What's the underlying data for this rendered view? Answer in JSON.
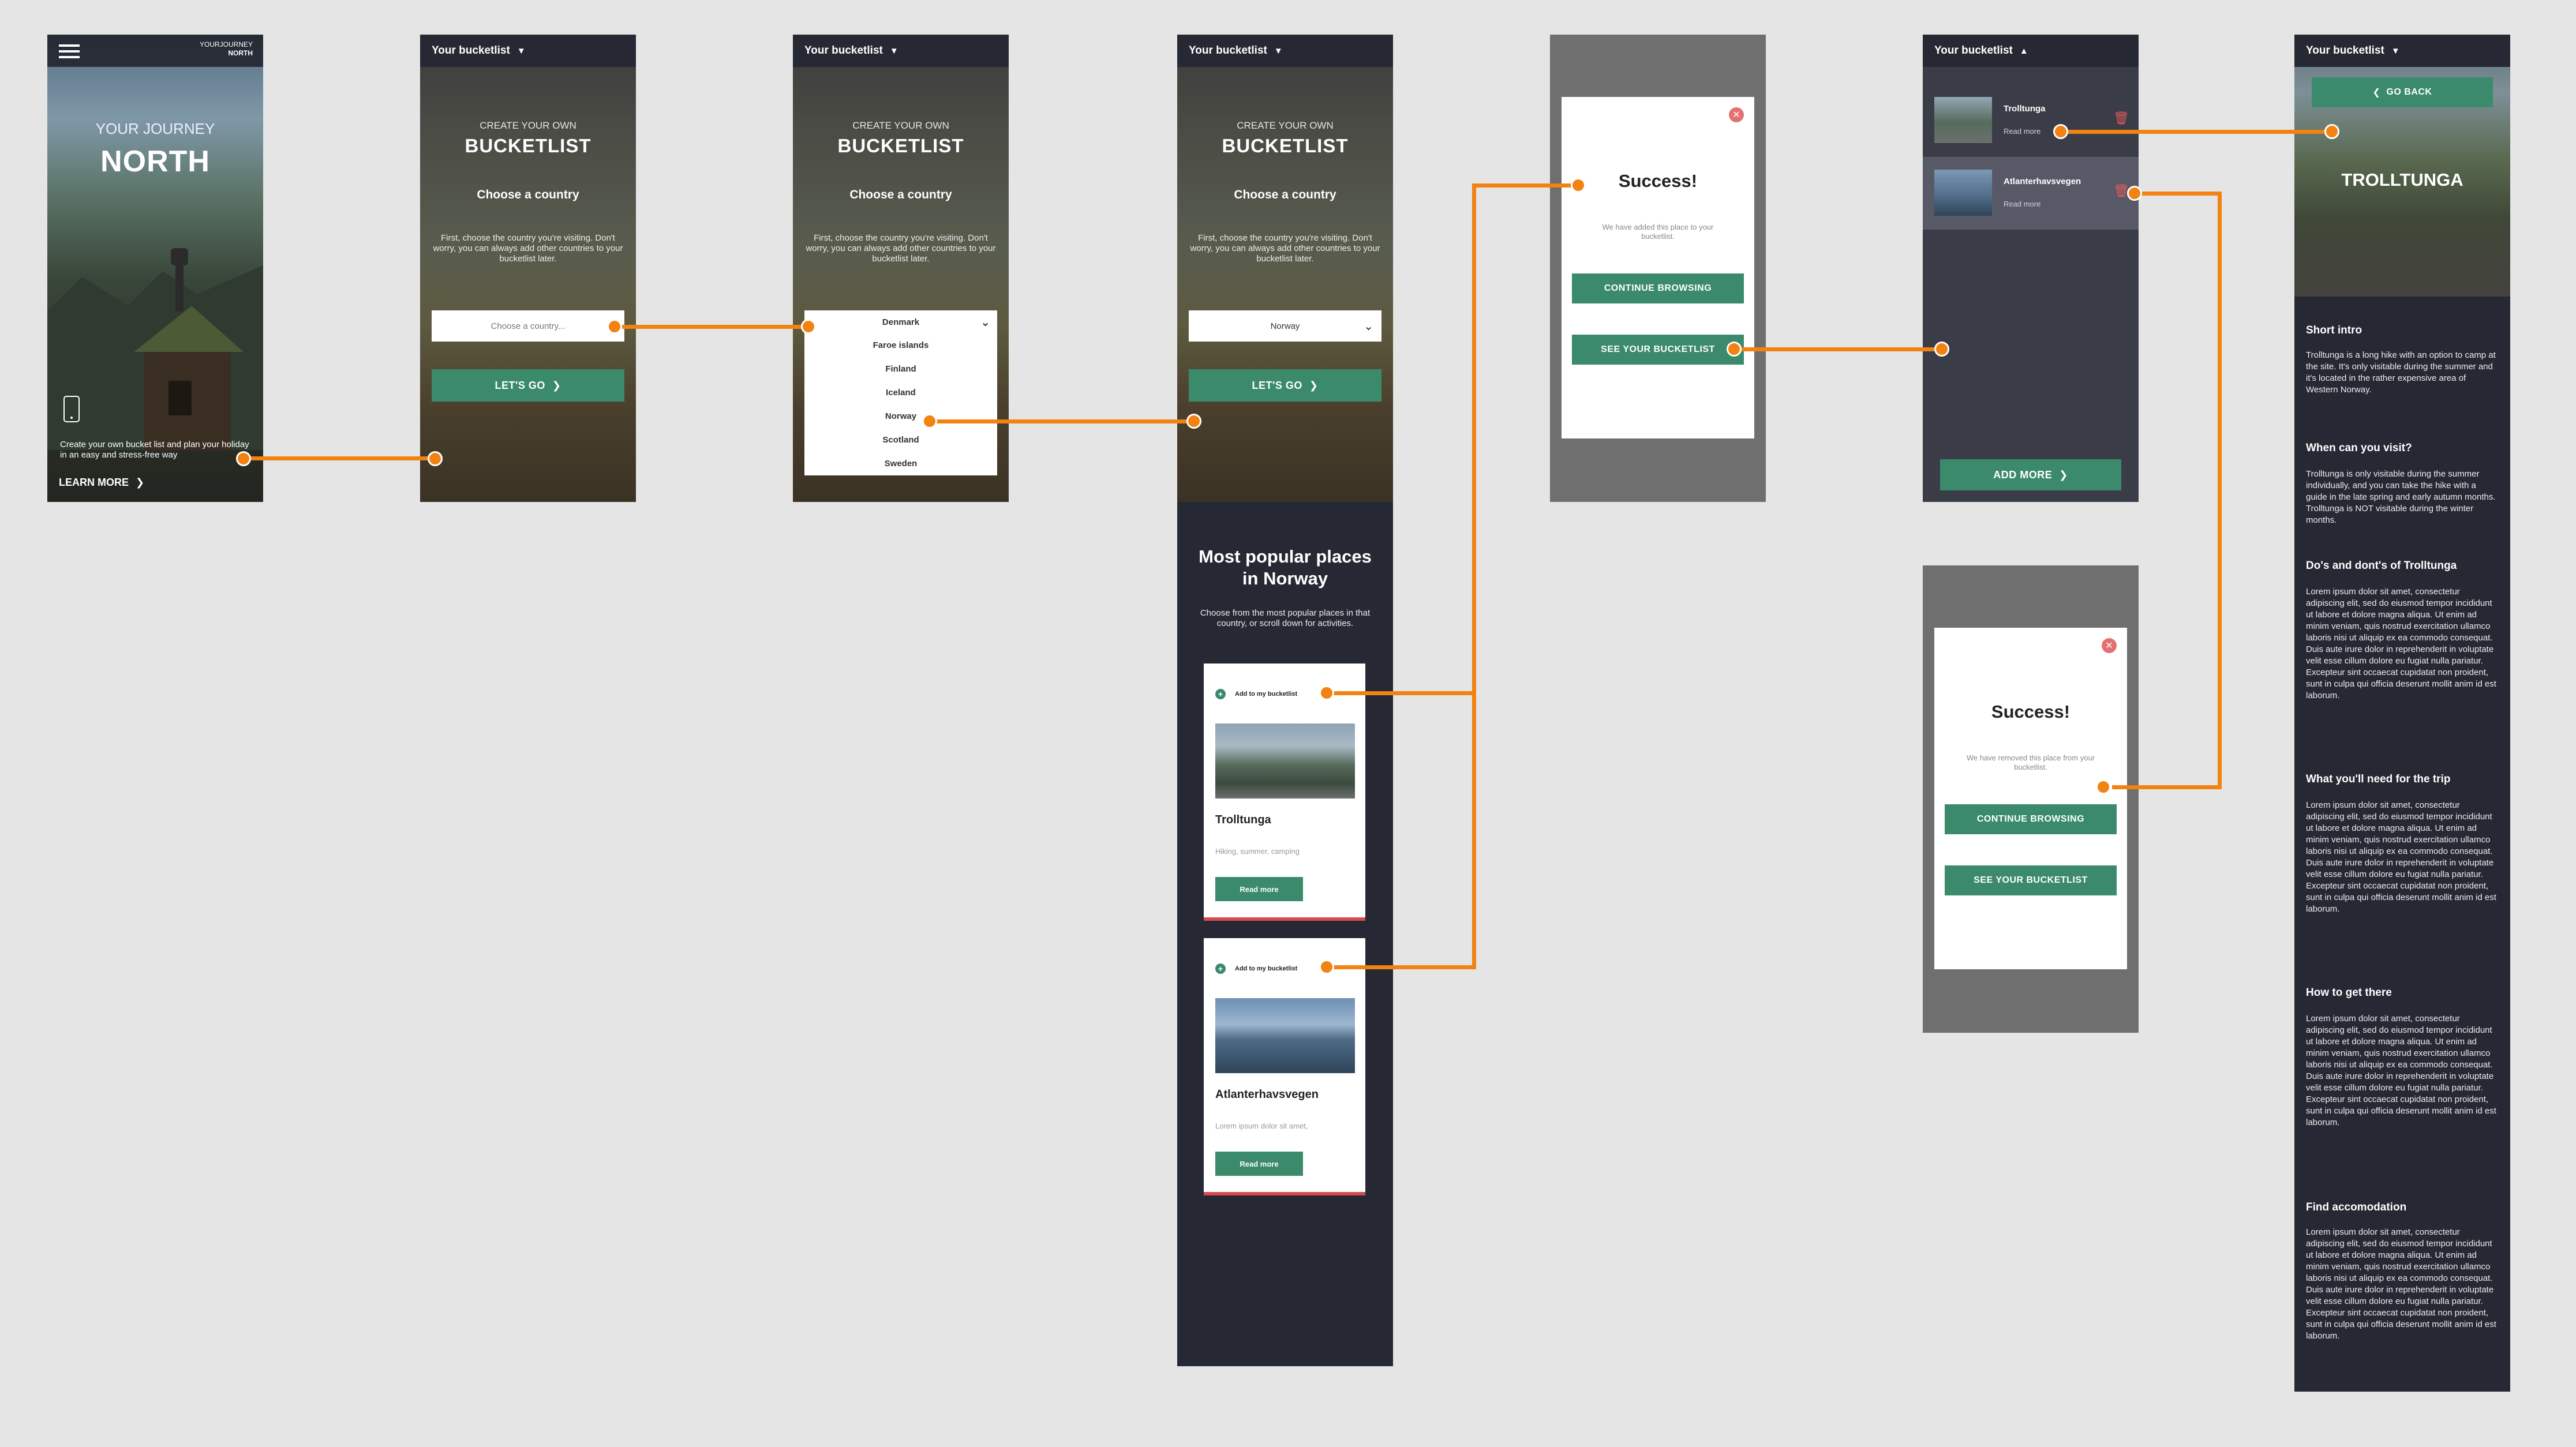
{
  "screen1": {
    "brand_top": "YOURJOURNEY",
    "brand_bottom": "NORTH",
    "hero_small": "YOUR JOURNEY",
    "hero_big": "NORTH",
    "tagline": "Create your own bucket list and plan your holiday in an easy and stress-free way",
    "learn_more": "LEARN MORE"
  },
  "header": {
    "title": "Your bucketlist"
  },
  "create": {
    "small": "CREATE YOUR OWN",
    "big": "BUCKETLIST",
    "choose": "Choose a country",
    "para": "First, choose the country you're visiting. Don't worry, you can always add other countries to your bucketlist later.",
    "placeholder": "Choose a country...",
    "lets_go": "LET'S GO"
  },
  "dropdown": {
    "options": [
      "Denmark",
      "Faroe islands",
      "Finland",
      "Iceland",
      "Norway",
      "Scotland",
      "Sweden"
    ]
  },
  "screen4": {
    "selected": "Norway",
    "popular_title_1": "Most popular places",
    "popular_title_2": "in Norway",
    "popular_para": "Choose from the most popular places in that country, or scroll down for activities.",
    "cards": [
      {
        "add": "Add to my bucketlist",
        "title": "Trolltunga",
        "sub": "Hiking, summer, camping",
        "btn": "Read more"
      },
      {
        "add": "Add to my bucketlist",
        "title": "Atlanterhavsvegen",
        "sub": "Lorem ipsum dolor sit amet,",
        "btn": "Read more"
      }
    ]
  },
  "success_add": {
    "title": "Success!",
    "msg": "We have added this place to your bucketlist.",
    "continue": "CONTINUE BROWSING",
    "see": "SEE YOUR BUCKETLIST"
  },
  "success_remove": {
    "title": "Success!",
    "msg": "We have removed this place from your bucketlist.",
    "continue": "CONTINUE BROWSING",
    "see": "SEE YOUR BUCKETLIST"
  },
  "bucketlist": {
    "items": [
      {
        "name": "Trolltunga",
        "read": "Read more"
      },
      {
        "name": "Atlanterhavsvegen",
        "read": "Read more"
      }
    ],
    "add_more": "ADD MORE"
  },
  "detail": {
    "go_back": "GO BACK",
    "hero_title": "TROLLTUNGA",
    "sections": [
      {
        "h": "Short intro",
        "p": "Trolltunga is a long hike with an option to camp at the site. It's only visitable during the summer and it's located in the rather expensive area of Western Norway."
      },
      {
        "h": "When can you visit?",
        "p": "Trolltunga is only visitable during the summer individually, and you can take the hike with a guide in the late spring and early autumn months. Trolltunga is NOT visitable during the winter months."
      },
      {
        "h": "Do's and dont's of Trolltunga",
        "p": "Lorem ipsum dolor sit amet, consectetur adipiscing elit, sed do eiusmod tempor incididunt ut labore et dolore magna aliqua. Ut enim ad minim veniam, quis nostrud exercitation ullamco laboris nisi ut aliquip ex ea commodo consequat. Duis aute irure dolor in reprehenderit in voluptate velit esse cillum dolore eu fugiat nulla pariatur. Excepteur sint occaecat cupidatat non proident, sunt in culpa qui officia deserunt mollit anim id est laborum."
      },
      {
        "h": "What you'll need for the trip",
        "p": "Lorem ipsum dolor sit amet, consectetur adipiscing elit, sed do eiusmod tempor incididunt ut labore et dolore magna aliqua. Ut enim ad minim veniam, quis nostrud exercitation ullamco laboris nisi ut aliquip ex ea commodo consequat. Duis aute irure dolor in reprehenderit in voluptate velit esse cillum dolore eu fugiat nulla pariatur. Excepteur sint occaecat cupidatat non proident, sunt in culpa qui officia deserunt mollit anim id est laborum."
      },
      {
        "h": "How to get there",
        "p": "Lorem ipsum dolor sit amet, consectetur adipiscing elit, sed do eiusmod tempor incididunt ut labore et dolore magna aliqua. Ut enim ad minim veniam, quis nostrud exercitation ullamco laboris nisi ut aliquip ex ea commodo consequat. Duis aute irure dolor in reprehenderit in voluptate velit esse cillum dolore eu fugiat nulla pariatur. Excepteur sint occaecat cupidatat non proident, sunt in culpa qui officia deserunt mollit anim id est laborum."
      },
      {
        "h": "Find accomodation",
        "p": "Lorem ipsum dolor sit amet, consectetur adipiscing elit, sed do eiusmod tempor incididunt ut labore et dolore magna aliqua. Ut enim ad minim veniam, quis nostrud exercitation ullamco laboris nisi ut aliquip ex ea commodo consequat. Duis aute irure dolor in reprehenderit in voluptate velit esse cillum dolore eu fugiat nulla pariatur. Excepteur sint occaecat cupidatat non proident, sunt in culpa qui officia deserunt mollit anim id est laborum."
      }
    ]
  },
  "colors": {
    "accent_green": "#3b8a6c",
    "connector_orange": "#f28212",
    "panel_dark": "#262833",
    "alert_red": "#e47171"
  }
}
